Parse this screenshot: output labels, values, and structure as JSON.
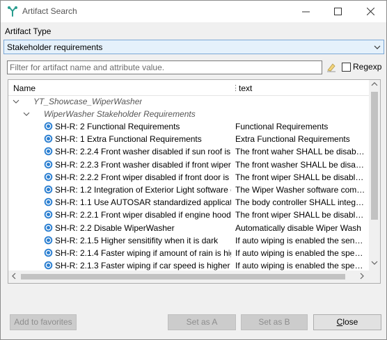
{
  "window": {
    "title": "Artifact Search",
    "controls": {
      "minimize": "—",
      "maximize": "☐",
      "close": "✕"
    }
  },
  "artifact_type": {
    "label": "Artifact Type",
    "selected": "Stakeholder requirements"
  },
  "filter": {
    "placeholder": "Filter for artifact name and attribute value.",
    "value": "",
    "regexp_label": "Regexp",
    "regexp_checked": false
  },
  "table": {
    "columns": [
      "Name",
      "text"
    ],
    "root": "YT_Showcase_WiperWasher",
    "group": "WiperWasher Stakeholder Requirements",
    "rows": [
      {
        "name": "SH-R: 2 Functional Requirements",
        "text": "Functional Requirements"
      },
      {
        "name": "SH-R: 1 Extra Functional Requirements",
        "text": "Extra Functional Requirements"
      },
      {
        "name": "SH-R: 2.2.4 Front washer disabled if sun roof is c",
        "text": "The front waher SHALL be disable..."
      },
      {
        "name": "SH-R: 2.2.3 Front washer disabled if front wiper c",
        "text": "The front washer SHALL be disable..."
      },
      {
        "name": "SH-R: 2.2.2 Front wiper disabled if front door is c",
        "text": "The front wiper SHALL be disabled..."
      },
      {
        "name": "SH-R: 1.2 Integration of Exterior Light software c",
        "text": "The Wiper Washer software comp..."
      },
      {
        "name": "SH-R: 1.1 Use AUTOSAR standardized applicatic",
        "text": "The body controller SHALL integra..."
      },
      {
        "name": "SH-R: 2.2.1 Front wiper disabled if engine hood",
        "text": "The front wiper SHALL be disabled..."
      },
      {
        "name": "SH-R: 2.2 Disable WiperWasher",
        "text": "Automatically disable Wiper Wash"
      },
      {
        "name": "SH-R: 2.1.5 Higher sensitifity when it is dark",
        "text": "If auto wiping is enabled the sensit..."
      },
      {
        "name": "SH-R: 2.1.4 Faster wiping if amount of rain is hig",
        "text": "If auto wiping is enabled the spee..."
      },
      {
        "name": "SH-R: 2.1.3 Faster wiping if car speed is higher",
        "text": "If auto wiping is enabled the spee..."
      }
    ]
  },
  "buttons": {
    "add_to_favorites": "Add to favorites",
    "set_as_a": "Set as A",
    "set_as_b": "Set as B",
    "close_first": "C",
    "close_rest": "lose"
  },
  "colors": {
    "selection": "#e5f1fb",
    "selection_border": "#7aa7d6",
    "requirement_icon": "#2b7fd1"
  },
  "icons": {
    "app": "artifact-search-app-icon",
    "clear": "clear-filter-icon",
    "requirement": "requirement-icon"
  }
}
